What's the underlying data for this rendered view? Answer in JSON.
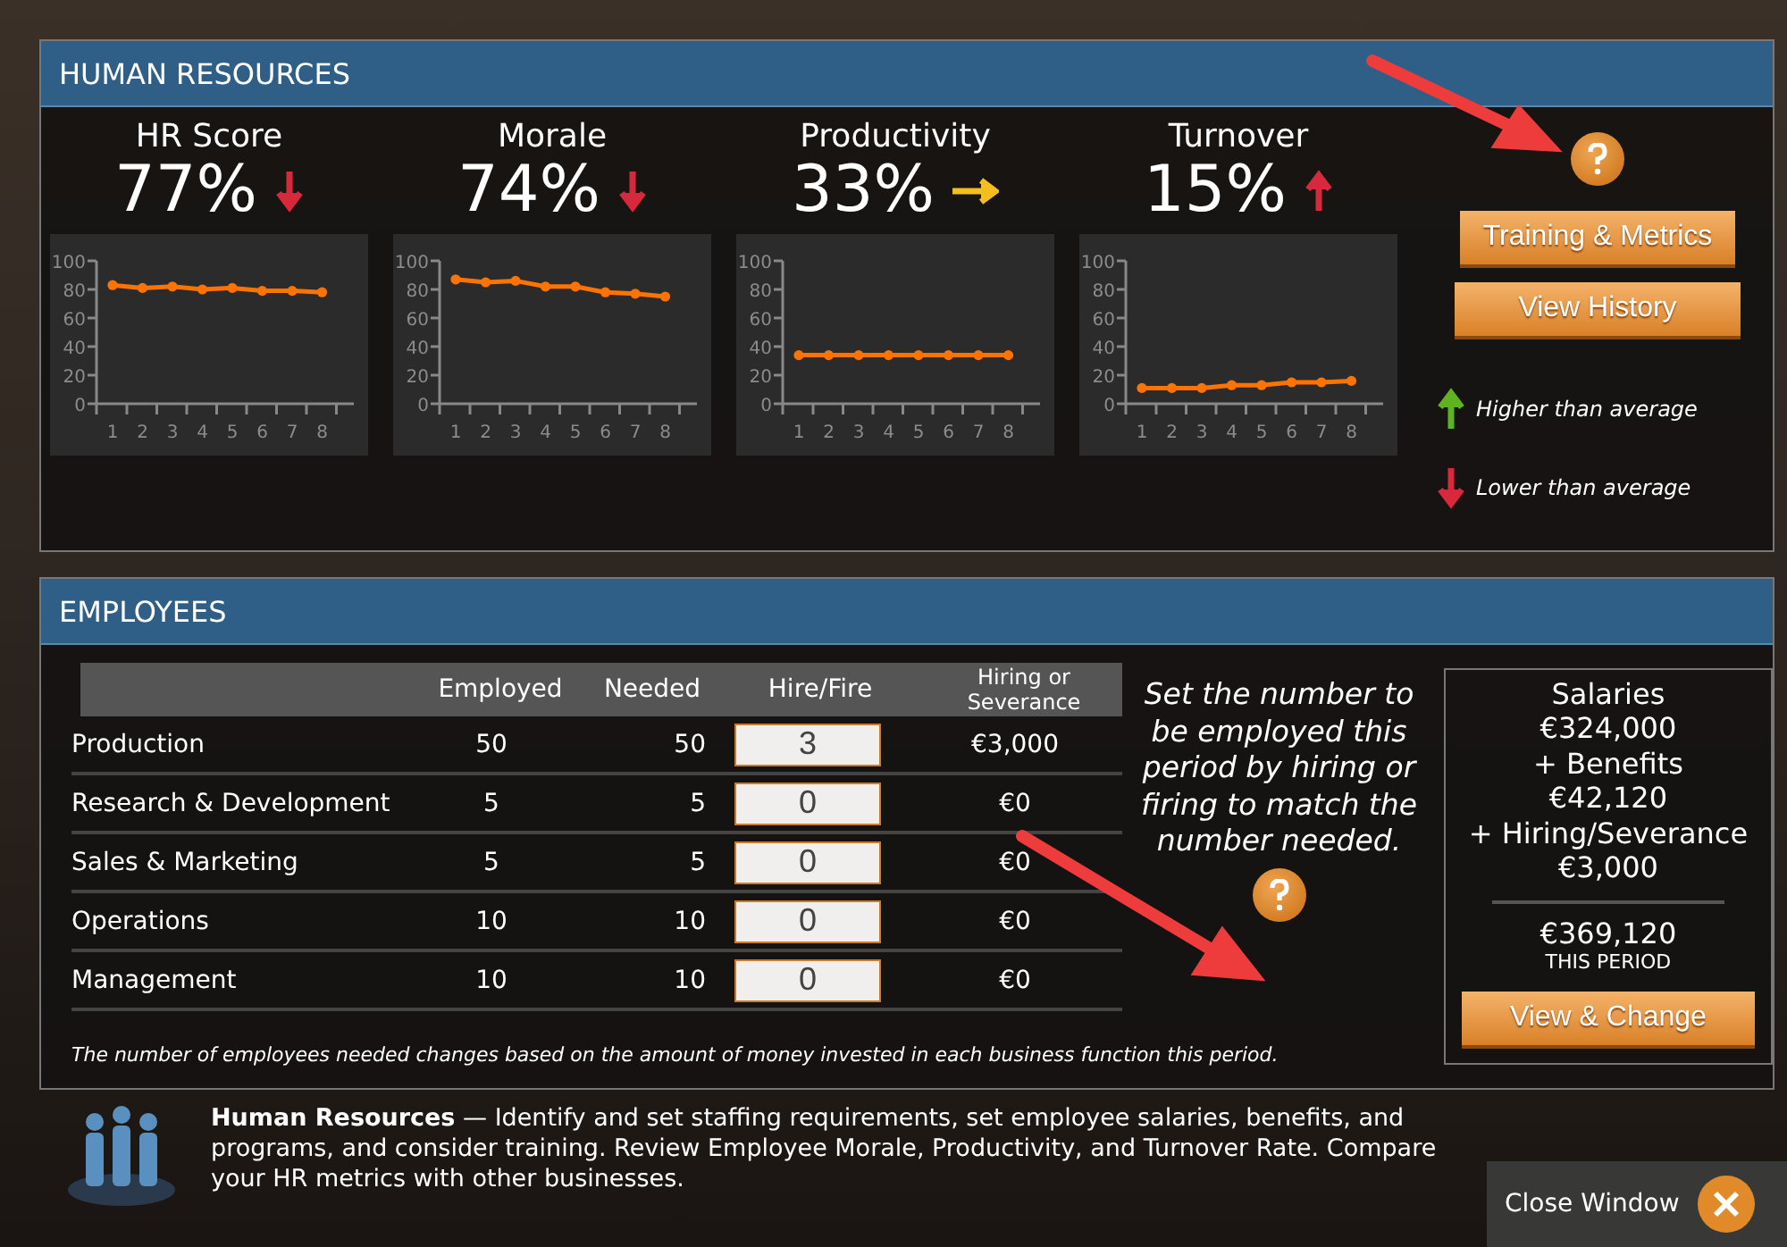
{
  "hr_panel": {
    "title": "HUMAN RESOURCES",
    "metrics": [
      {
        "value": "77%",
        "kind": "down",
        "color": "#d8283c",
        "chart_data": {
          "type": "line",
          "title": "HR Score",
          "categories": [
            "1",
            "2",
            "3",
            "4",
            "5",
            "6",
            "7",
            "8"
          ],
          "series": [
            {
              "color": "#ff7300",
              "marker": "circle",
              "values": [
                83,
                81,
                82,
                80,
                81,
                79,
                79,
                78
              ]
            }
          ],
          "ylim": [
            0,
            100
          ],
          "yticks": [
            0,
            20,
            40,
            60,
            80,
            100
          ]
        }
      },
      {
        "value": "74%",
        "kind": "down",
        "color": "#d8283c",
        "chart_data": {
          "type": "line",
          "title": "Morale",
          "categories": [
            "1",
            "2",
            "3",
            "4",
            "5",
            "6",
            "7",
            "8"
          ],
          "series": [
            {
              "color": "#ff7300",
              "marker": "circle",
              "values": [
                87,
                85,
                86,
                82,
                82,
                78,
                77,
                75
              ]
            }
          ],
          "ylim": [
            0,
            100
          ],
          "yticks": [
            0,
            20,
            40,
            60,
            80,
            100
          ]
        }
      },
      {
        "value": "33%",
        "kind": "right",
        "color": "#f2c01e",
        "chart_data": {
          "type": "line",
          "title": "Productivity",
          "categories": [
            "1",
            "2",
            "3",
            "4",
            "5",
            "6",
            "7",
            "8"
          ],
          "series": [
            {
              "color": "#ff7300",
              "marker": "circle",
              "values": [
                34,
                34,
                34,
                34,
                34,
                34,
                34,
                34
              ]
            }
          ],
          "ylim": [
            0,
            100
          ],
          "yticks": [
            0,
            20,
            40,
            60,
            80,
            100
          ]
        }
      },
      {
        "value": "15%",
        "kind": "up",
        "color": "#d8283c",
        "chart_data": {
          "type": "line",
          "title": "Turnover",
          "categories": [
            "1",
            "2",
            "3",
            "4",
            "5",
            "6",
            "7",
            "8"
          ],
          "series": [
            {
              "color": "#ff7300",
              "marker": "circle",
              "values": [
                11,
                11,
                11,
                13,
                13,
                15,
                15,
                16
              ]
            }
          ],
          "ylim": [
            0,
            100
          ],
          "yticks": [
            0,
            20,
            40,
            60,
            80,
            100
          ]
        }
      }
    ],
    "buttons": [
      "Training & Metrics",
      "View History"
    ],
    "legend": [
      {
        "kind": "up",
        "color": "#5fb31e",
        "text": "Higher than average"
      },
      {
        "kind": "down",
        "color": "#d8283c",
        "text": "Lower than average"
      }
    ]
  },
  "employees_panel": {
    "title": "EMPLOYEES",
    "columns": [
      "Employed",
      "Needed",
      "Hire/Fire",
      "Hiring or Severance"
    ],
    "rows": [
      {
        "department": "Production",
        "employed": "50",
        "needed": "50",
        "hire_fire": "3",
        "cost": "€3,000"
      },
      {
        "department": "Research & Development",
        "employed": "5",
        "needed": "5",
        "hire_fire": "0",
        "cost": "€0"
      },
      {
        "department": "Sales & Marketing",
        "employed": "5",
        "needed": "5",
        "hire_fire": "0",
        "cost": "€0"
      },
      {
        "department": "Operations",
        "employed": "10",
        "needed": "10",
        "hire_fire": "0",
        "cost": "€0"
      },
      {
        "department": "Management",
        "employed": "10",
        "needed": "10",
        "hire_fire": "0",
        "cost": "€0"
      }
    ],
    "note": "The number of employees needed changes based on the amount of money invested in each business function this period.",
    "hint": "Set the number to be employed this period by hiring or firing to match the number needed.",
    "summary": {
      "lines": [
        "Salaries",
        "€324,000",
        "+ Benefits",
        "€42,120",
        "+ Hiring/Severance",
        "€3,000"
      ],
      "total": "€369,120",
      "total_label": "THIS PERIOD",
      "button": "View & Change"
    }
  },
  "footer": {
    "text": "**Human Resources** — Identify and set staffing requirements, set employee salaries, benefits, and programs, and consider training. Review Employee Morale, Productivity, and Turnover Rate. Compare your HR metrics with other businesses.",
    "close_button": "Close Window"
  }
}
